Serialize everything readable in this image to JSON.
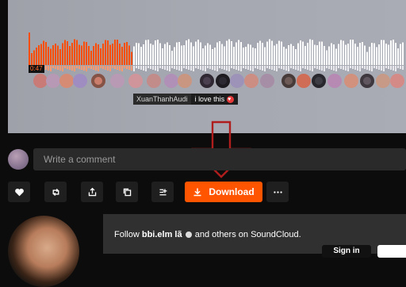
{
  "player": {
    "current_time": "0:47",
    "played_fraction": 0.28
  },
  "timed_comment": {
    "user": "XuanThanhAudi",
    "text": "i love this",
    "emoji_icon": "red-heart-emoji-icon"
  },
  "comment": {
    "placeholder": "Write a comment"
  },
  "actions": {
    "like_icon": "heart-icon",
    "repost_icon": "repost-icon",
    "share_icon": "share-icon",
    "copy_icon": "copy-link-icon",
    "playlist_icon": "add-to-playlist-icon",
    "download_label": "Download",
    "more_icon": "more-options-icon"
  },
  "follow_prompt": {
    "text_prefix": "Follow",
    "username": "bbi.elm lã",
    "text_suffix": "and others on SoundCloud.",
    "signin_label": "Sign in"
  },
  "colors": {
    "accent": "#ff5500",
    "background": "#0c0c0c",
    "overlay_arrow": "#b01d1d"
  }
}
